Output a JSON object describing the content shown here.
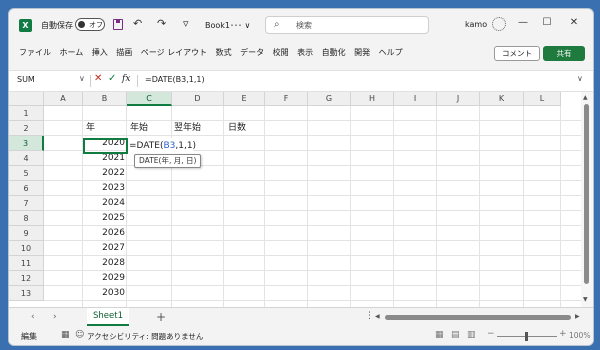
{
  "titlebar": {
    "app_icon": "X",
    "autosave_label": "自動保存",
    "autosave_toggle": "オフ",
    "book_title": "Book1･･･ ∨",
    "search_placeholder": "検索",
    "user_name": "kamo",
    "undo_glyph": "↶",
    "redo_glyph": "↷",
    "customize_glyph": "▿",
    "search_glyph": "⌕",
    "minimize_glyph": "—",
    "maximize_glyph": "☐",
    "close_glyph": "✕"
  },
  "menu": {
    "items": [
      "ファイル",
      "ホーム",
      "挿入",
      "描画",
      "ページ レイアウト",
      "数式",
      "データ",
      "校閲",
      "表示",
      "自動化",
      "開発",
      "ヘルプ"
    ],
    "comment_button": "コメント",
    "share_button": "共有"
  },
  "formula_bar": {
    "name_box": "SUM",
    "cancel_glyph": "✕",
    "enter_glyph": "✓",
    "fx_label": "fx",
    "formula": "=DATE(B3,1,1)"
  },
  "sheet": {
    "columns": [
      "A",
      "B",
      "C",
      "D",
      "E",
      "F",
      "G",
      "H",
      "I",
      "J",
      "K",
      "L"
    ],
    "active_column": "C",
    "active_row": 3,
    "rows": [
      "1",
      "2",
      "3",
      "4",
      "5",
      "6",
      "7",
      "8",
      "9",
      "10",
      "11",
      "12",
      "13"
    ],
    "headers": {
      "B2": "年",
      "C2": "年始",
      "D2": "翌年始",
      "E2": "日数"
    },
    "years": [
      "2020",
      "2021",
      "2022",
      "2023",
      "2024",
      "2025",
      "2026",
      "2027",
      "2028",
      "2029",
      "2030"
    ],
    "edit_cell": {
      "prefix": "=DATE(",
      "ref": "B3",
      "suffix": ",1,1)"
    },
    "tooltip": "DATE(年, 月, 日)"
  },
  "tabs": {
    "sheet_name": "Sheet1",
    "add_glyph": "+",
    "prev_glyph": "‹",
    "next_glyph": "›",
    "more_glyph": "⋮"
  },
  "status": {
    "mode": "編集",
    "accessibility": "アクセシビリティ: 問題ありません",
    "zoom": "100%"
  }
}
